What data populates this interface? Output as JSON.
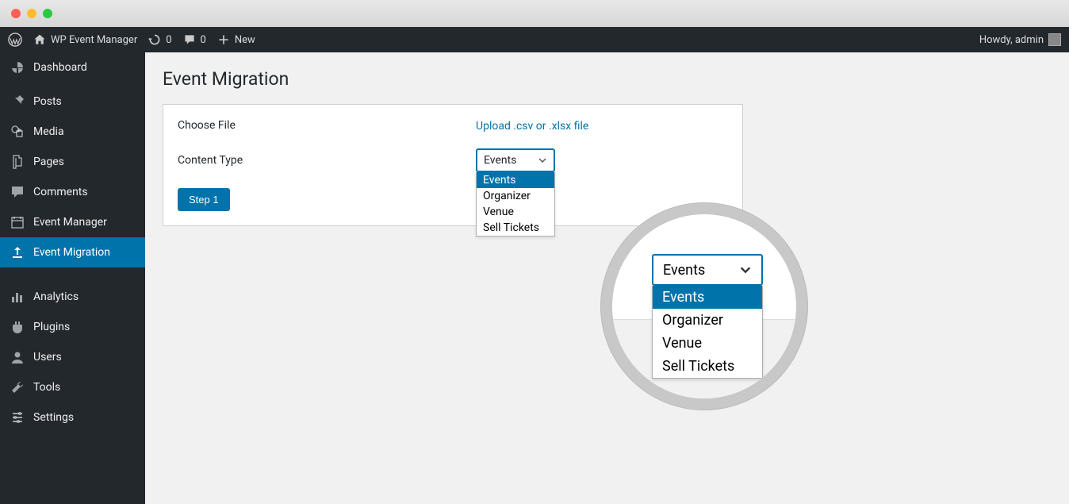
{
  "adminbar": {
    "site_name": "WP Event Manager",
    "updates_count": "0",
    "comments_count": "0",
    "new_label": "New",
    "greeting": "Howdy, admin"
  },
  "sidebar": {
    "items": [
      {
        "label": "Dashboard",
        "icon": "dashboard"
      },
      {
        "label": "Posts",
        "icon": "pin"
      },
      {
        "label": "Media",
        "icon": "media"
      },
      {
        "label": "Pages",
        "icon": "pages"
      },
      {
        "label": "Comments",
        "icon": "comment"
      },
      {
        "label": "Event Manager",
        "icon": "calendar"
      },
      {
        "label": "Event Migration",
        "icon": "upload",
        "current": true
      },
      {
        "label": "Analytics",
        "icon": "chart"
      },
      {
        "label": "Plugins",
        "icon": "plugin"
      },
      {
        "label": "Users",
        "icon": "user"
      },
      {
        "label": "Tools",
        "icon": "wrench"
      },
      {
        "label": "Settings",
        "icon": "settings"
      }
    ]
  },
  "page": {
    "title": "Event Migration",
    "choose_file_label": "Choose File",
    "upload_link_text": "Upload .csv or .xlsx file",
    "content_type_label": "Content Type",
    "step_button": "Step 1",
    "select_value": "Events",
    "select_options": [
      "Events",
      "Organizer",
      "Venue",
      "Sell Tickets"
    ]
  },
  "magnifier": {
    "select_value": "Events",
    "options": [
      "Events",
      "Organizer",
      "Venue",
      "Sell Tickets"
    ]
  }
}
